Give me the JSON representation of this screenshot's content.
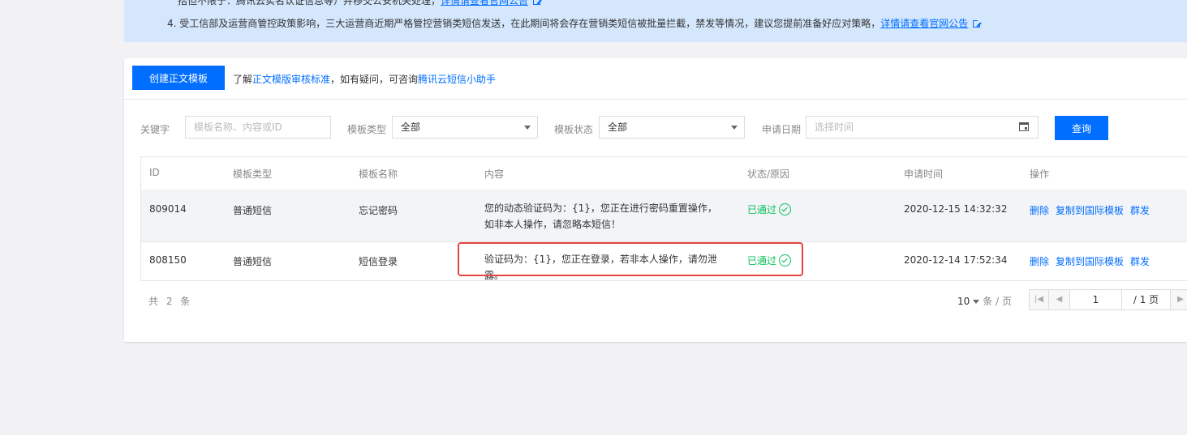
{
  "notice": {
    "line1_text": "括但不限于：腾讯云实名认证信息等）并移交公安机关处理，",
    "line1_link": "详情请查看官网公告",
    "line2_text": "4. 受工信部及运营商管控政策影响，三大运营商近期严格管控营销类短信发送，在此期间将会存在营销类短信被批量拦截，禁发等情况，建议您提前准备好应对策略，",
    "line2_link": "详情请查看官网公告"
  },
  "toolbar": {
    "create_label": "创建正文模板",
    "tip_prefix": "了解",
    "tip_link1": "正文模版审核标准",
    "tip_middle": "，如有疑问，可咨询",
    "tip_link2": "腾讯云短信小助手"
  },
  "filters": {
    "keyword_label": "关键字",
    "keyword_placeholder": "模板名称、内容或ID",
    "type_label": "模板类型",
    "type_value": "全部",
    "status_label": "模板状态",
    "status_value": "全部",
    "date_label": "申请日期",
    "date_placeholder": "选择时间",
    "query_label": "查询"
  },
  "table": {
    "headers": [
      "ID",
      "模板类型",
      "模板名称",
      "内容",
      "状态/原因",
      "申请时间",
      "操作"
    ],
    "rows": [
      {
        "id": "809014",
        "type": "普通短信",
        "name": "忘记密码",
        "content": "您的动态验证码为：{1}，您正在进行密码重置操作，如非本人操作，请忽略本短信！",
        "status": "已通过",
        "time": "2020-12-15 14:32:32",
        "actions": [
          "删除",
          "复制到国际模板",
          "群发"
        ]
      },
      {
        "id": "808150",
        "type": "普通短信",
        "name": "短信登录",
        "content": "验证码为：{1}，您正在登录，若非本人操作，请勿泄露。",
        "status": "已通过",
        "time": "2020-12-14 17:52:34",
        "actions": [
          "删除",
          "复制到国际模板",
          "群发"
        ]
      }
    ]
  },
  "footer": {
    "total": "共 2 条",
    "page_size": "10",
    "page_size_unit": "条 / 页",
    "current_page": "1",
    "total_pages": "/ 1 页"
  },
  "colors": {
    "primary": "#006eff",
    "success": "#0abf5b",
    "highlight": "#e54545"
  }
}
